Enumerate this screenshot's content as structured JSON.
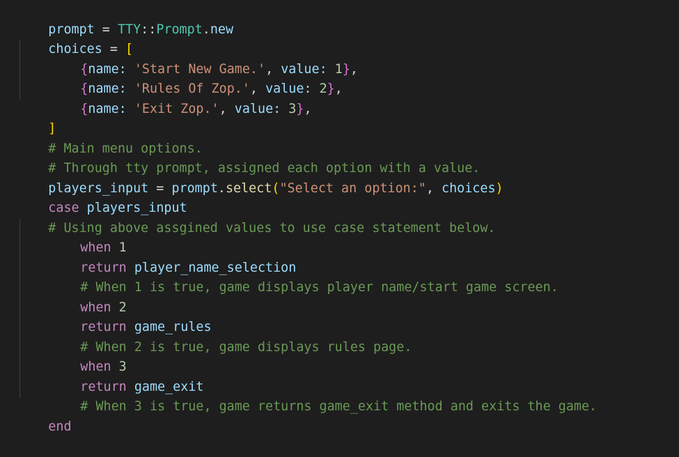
{
  "code": {
    "l1": {
      "var": "prompt",
      "eq": " = ",
      "cls": "TTY",
      "sep": "::",
      "cls2": "Prompt",
      "dot": ".",
      "fn": "new"
    },
    "l2": {
      "var": "choices",
      "eq": " = ",
      "open": "["
    },
    "choices": [
      {
        "open": "{",
        "k1": "name:",
        "v1": "'Start New Game.'",
        "c": ", ",
        "k2": "value:",
        "v2": "1",
        "close": "}",
        "tail": ","
      },
      {
        "open": "{",
        "k1": "name:",
        "v1": "'Rules Of Zop.'",
        "c": ", ",
        "k2": "value:",
        "v2": "2",
        "close": "}",
        "tail": ","
      },
      {
        "open": "{",
        "k1": "name:",
        "v1": "'Exit Zop.'",
        "c": ", ",
        "k2": "value:",
        "v2": "3",
        "close": "}",
        "tail": ","
      }
    ],
    "l6": {
      "close": "]"
    },
    "l7": {
      "comment": "# Main menu options."
    },
    "l8": {
      "comment": "# Through tty prompt, assigned each option with a value."
    },
    "l9": {
      "var": "players_input",
      "eq": " = ",
      "obj": "prompt",
      "dot": ".",
      "fn": "select",
      "open": "(",
      "str": "\"Select an option:\"",
      "comma": ", ",
      "arg": "choices",
      "close": ")"
    },
    "l10": {
      "kw": "case",
      "sp": " ",
      "var": "players_input"
    },
    "l11": {
      "comment": "# Using above assgined values to use case statement below."
    },
    "branches": [
      {
        "when": "when",
        "num": "1",
        "ret": "return",
        "target": "player_name_selection",
        "comment": "# When 1 is true, game displays player name/start game screen."
      },
      {
        "when": "when",
        "num": "2",
        "ret": "return",
        "target": "game_rules",
        "comment": "# When 2 is true, game displays rules page."
      },
      {
        "when": "when",
        "num": "3",
        "ret": "return",
        "target": "game_exit",
        "comment": "# When 3 is true, game returns game_exit method and exits the game."
      }
    ],
    "end": {
      "kw": "end"
    }
  },
  "colors": {
    "background": "#1e1e1e",
    "variable": "#9cdcfe",
    "class": "#4ec9b0",
    "function": "#dcdcaa",
    "keyword": "#c586c0",
    "string": "#ce9178",
    "number": "#b5cea8",
    "comment": "#6a9955",
    "bracket_level1": "#ffd700",
    "bracket_level2": "#da70d6"
  }
}
